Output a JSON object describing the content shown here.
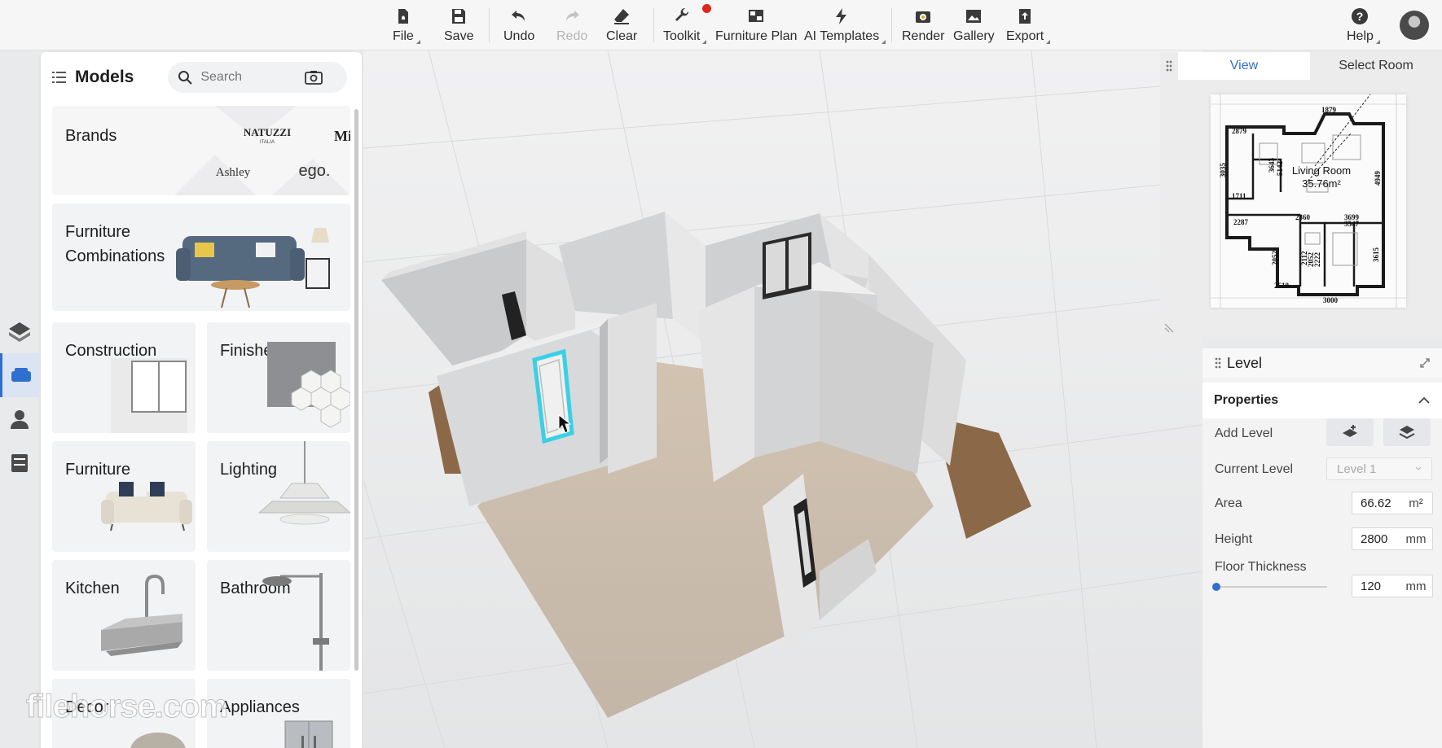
{
  "toolbar": {
    "file": "File",
    "save": "Save",
    "undo": "Undo",
    "redo": "Redo",
    "clear": "Clear",
    "toolkit": "Toolkit",
    "furniture_plan": "Furniture Plan",
    "ai_templates": "AI Templates",
    "render": "Render",
    "gallery": "Gallery",
    "export": "Export",
    "help": "Help"
  },
  "models": {
    "title": "Models",
    "search_placeholder": "Search",
    "brands": {
      "label": "Brands",
      "logos": [
        "NATUZZI",
        "ITALIA",
        "Mi",
        "Ashley",
        "ego."
      ]
    },
    "categories": [
      {
        "label": "Furniture Combinations"
      },
      {
        "label": "Construction"
      },
      {
        "label": "Finishes"
      },
      {
        "label": "Furniture"
      },
      {
        "label": "Lighting"
      },
      {
        "label": "Kitchen"
      },
      {
        "label": "Bathroom"
      },
      {
        "label": "Décor"
      },
      {
        "label": "Appliances"
      }
    ]
  },
  "view_panel": {
    "tabs": [
      "View",
      "Select Room"
    ],
    "active_tab": "View",
    "room_name": "Living Room",
    "room_area": "35.76m²",
    "dimensions": [
      "1879",
      "2879",
      "3035",
      "3643",
      "5142",
      "1711",
      "4949",
      "2287",
      "2360",
      "3699",
      "3547",
      "2052",
      "2112",
      "2052",
      "2222",
      "3615",
      "2618",
      "3000"
    ]
  },
  "level": {
    "title": "Level",
    "section": "Properties",
    "add_level_label": "Add Level",
    "current_level_label": "Current Level",
    "current_level_value": "Level 1",
    "area_label": "Area",
    "area_value": "66.62",
    "area_unit": "m²",
    "height_label": "Height",
    "height_value": "2800",
    "height_unit": "mm",
    "floor_thickness_label": "Floor Thickness",
    "floor_thickness_value": "120",
    "floor_thickness_unit": "mm",
    "floor_thickness_slider_fraction": 0.0
  },
  "watermark": "filehorse.com",
  "colors": {
    "accent": "#2f6fd1",
    "notification": "#e0261c",
    "selection": "#3ad0e6",
    "floor": "#c8b8a6"
  }
}
